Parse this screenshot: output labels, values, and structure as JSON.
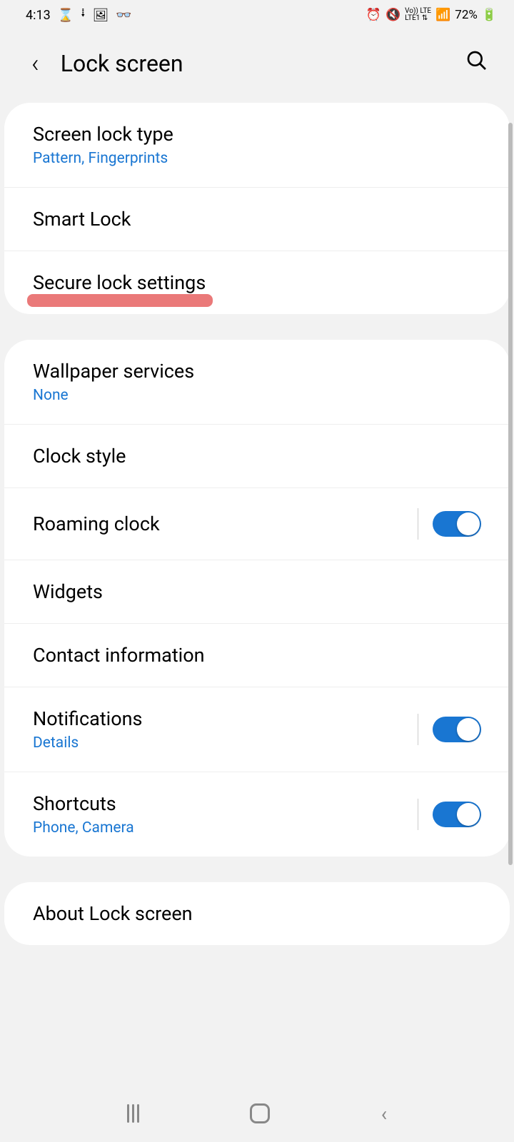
{
  "statusBar": {
    "time": "4:13",
    "battery": "72%"
  },
  "header": {
    "title": "Lock screen"
  },
  "card1": {
    "items": [
      {
        "title": "Screen lock type",
        "subtitle": "Pattern, Fingerprints"
      },
      {
        "title": "Smart Lock"
      },
      {
        "title": "Secure lock settings"
      }
    ]
  },
  "card2": {
    "items": [
      {
        "title": "Wallpaper services",
        "subtitle": "None"
      },
      {
        "title": "Clock style"
      },
      {
        "title": "Roaming clock",
        "toggle": true
      },
      {
        "title": "Widgets"
      },
      {
        "title": "Contact information"
      },
      {
        "title": "Notifications",
        "subtitle": "Details",
        "toggle": true
      },
      {
        "title": "Shortcuts",
        "subtitle": "Phone, Camera",
        "toggle": true
      }
    ]
  },
  "card3": {
    "items": [
      {
        "title": "About Lock screen"
      }
    ]
  }
}
